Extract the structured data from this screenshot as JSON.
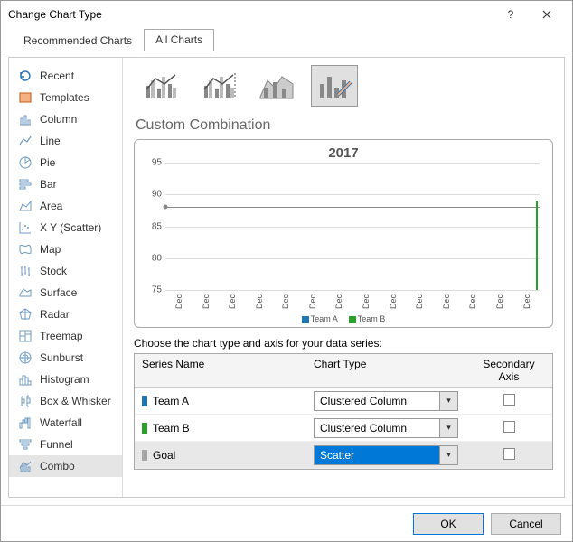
{
  "window": {
    "title": "Change Chart Type",
    "help": "?",
    "close": "✕"
  },
  "tabs": {
    "recommended": "Recommended Charts",
    "all": "All Charts"
  },
  "sidebar": {
    "items": [
      {
        "label": "Recent"
      },
      {
        "label": "Templates"
      },
      {
        "label": "Column"
      },
      {
        "label": "Line"
      },
      {
        "label": "Pie"
      },
      {
        "label": "Bar"
      },
      {
        "label": "Area"
      },
      {
        "label": "X Y (Scatter)"
      },
      {
        "label": "Map"
      },
      {
        "label": "Stock"
      },
      {
        "label": "Surface"
      },
      {
        "label": "Radar"
      },
      {
        "label": "Treemap"
      },
      {
        "label": "Sunburst"
      },
      {
        "label": "Histogram"
      },
      {
        "label": "Box & Whisker"
      },
      {
        "label": "Waterfall"
      },
      {
        "label": "Funnel"
      },
      {
        "label": "Combo"
      }
    ]
  },
  "panel": {
    "heading": "Custom Combination"
  },
  "chart": {
    "title": "2017",
    "yticks": [
      "95",
      "90",
      "85",
      "80",
      "75"
    ],
    "xticks": [
      "Dec",
      "Dec",
      "Dec",
      "Dec",
      "Dec",
      "Dec",
      "Dec",
      "Dec",
      "Dec",
      "Dec",
      "Dec",
      "Dec",
      "Dec",
      "Dec"
    ],
    "legend": [
      {
        "label": "Team A",
        "color": "#1f77b4"
      },
      {
        "label": "Team B",
        "color": "#2ca02c"
      }
    ]
  },
  "chart_data": {
    "type": "line",
    "title": "2017",
    "xlabel": "",
    "ylabel": "",
    "ylim": [
      75,
      95
    ],
    "x": [
      "Dec",
      "Dec",
      "Dec",
      "Dec",
      "Dec",
      "Dec",
      "Dec",
      "Dec",
      "Dec",
      "Dec",
      "Dec",
      "Dec",
      "Dec",
      "Dec"
    ],
    "series": [
      {
        "name": "Team A",
        "values": [
          88,
          88,
          88,
          88,
          88,
          88,
          88,
          88,
          88,
          88,
          88,
          88,
          88,
          88
        ]
      },
      {
        "name": "Team B",
        "values": [
          null,
          null,
          null,
          null,
          null,
          null,
          null,
          null,
          null,
          null,
          null,
          null,
          null,
          89
        ]
      }
    ]
  },
  "series_area": {
    "caption": "Choose the chart type and axis for your data series:",
    "headers": {
      "name": "Series Name",
      "type": "Chart Type",
      "axis": "Secondary Axis"
    },
    "rows": [
      {
        "name": "Team A",
        "color": "#1f77b4",
        "type": "Clustered Column",
        "secondary": false
      },
      {
        "name": "Team B",
        "color": "#2ca02c",
        "type": "Clustered Column",
        "secondary": false
      },
      {
        "name": "Goal",
        "color": "#a6a6a6",
        "type": "Scatter",
        "secondary": false
      }
    ]
  },
  "footer": {
    "ok": "OK",
    "cancel": "Cancel"
  }
}
